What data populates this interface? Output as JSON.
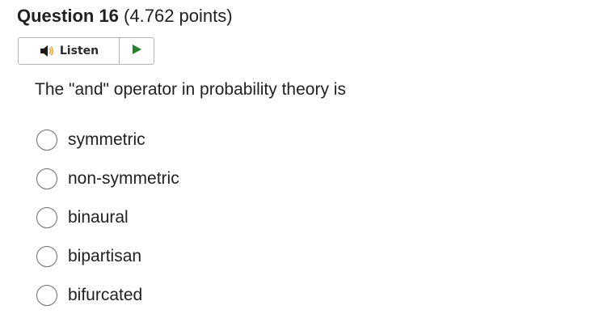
{
  "question": {
    "title": "Question 16",
    "points": "(4.762 points)",
    "text": "The \"and\" operator in probability theory is"
  },
  "listen": {
    "label": "Listen",
    "speaker_icon": "speaker-icon",
    "play_icon": "play-icon",
    "play_color": "#2e7d32"
  },
  "options": [
    {
      "label": "symmetric",
      "selected": false
    },
    {
      "label": "non-symmetric",
      "selected": false
    },
    {
      "label": "binaural",
      "selected": false
    },
    {
      "label": "bipartisan",
      "selected": false
    },
    {
      "label": "bifurcated",
      "selected": false
    }
  ]
}
